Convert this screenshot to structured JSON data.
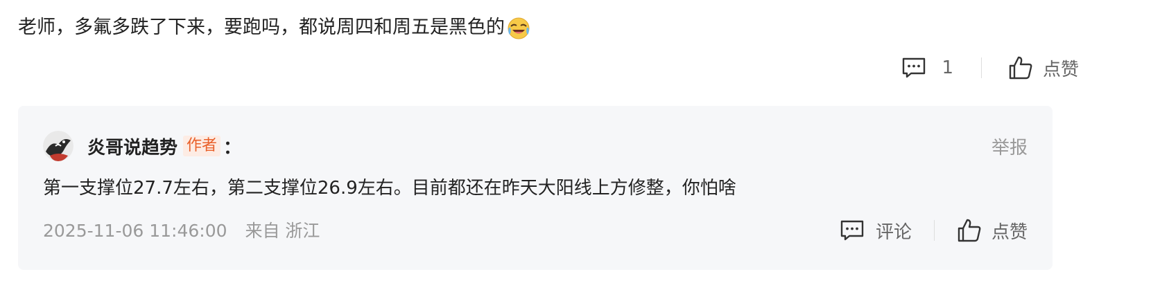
{
  "comment": {
    "text": "老师，多氟多跌了下来，要跑吗，都说周四和周五是黑色的",
    "emoji": "laughing-crying-emoji",
    "actions": {
      "reply_count": "1",
      "like_label": "点赞"
    }
  },
  "reply": {
    "author_name": "炎哥说趋势",
    "author_badge": "作者",
    "colon": "：",
    "report_label": "举报",
    "text": "第一支撑位27.7左右，第二支撑位26.9左右。目前都还在昨天大阳线上方修整，你怕啥",
    "timestamp": "2025-11-06 11:46:00",
    "location": "来自 浙江",
    "actions": {
      "comment_label": "评论",
      "like_label": "点赞"
    }
  },
  "colors": {
    "badge_text": "#e9602a",
    "badge_bg": "#fdece4",
    "reply_bg": "#f6f7f9"
  }
}
